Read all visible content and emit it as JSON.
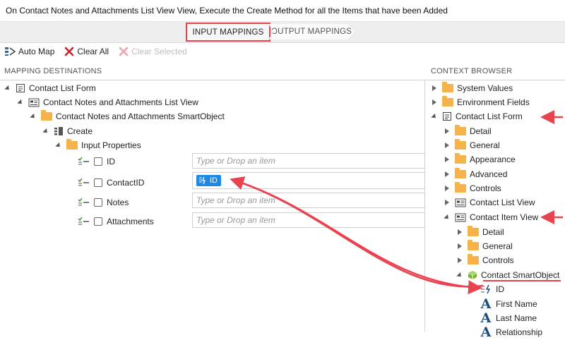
{
  "title": "On Contact Notes and Attachments List View View, Execute the Create Method for all the Items that have been Added",
  "steps": {
    "input": "INPUT MAPPINGS",
    "output": "OUTPUT MAPPINGS"
  },
  "toolbar": {
    "auto_map": "Auto Map",
    "clear_all": "Clear All",
    "clear_selected": "Clear Selected"
  },
  "mapping": {
    "header": "MAPPING DESTINATIONS",
    "form": "Contact List Form",
    "view": "Contact Notes and Attachments List View",
    "smartobject": "Contact Notes and Attachments SmartObject",
    "method": "Create",
    "input_props": "Input Properties",
    "placeholder": "Type or Drop an item",
    "props": [
      {
        "name": "ID",
        "value": ""
      },
      {
        "name": "ContactID",
        "value": "ID"
      },
      {
        "name": "Notes",
        "value": ""
      },
      {
        "name": "Attachments",
        "value": ""
      }
    ]
  },
  "context": {
    "header": "CONTEXT BROWSER",
    "system_values": "System Values",
    "env_fields": "Environment Fields",
    "form": "Contact List Form",
    "form_children": [
      "Detail",
      "General",
      "Appearance",
      "Advanced",
      "Controls"
    ],
    "list_view": "Contact List View",
    "item_view": "Contact Item View",
    "item_view_children": [
      "Detail",
      "General",
      "Controls"
    ],
    "smartobject": "Contact SmartObject",
    "fields": [
      "ID",
      "First Name",
      "Last Name",
      "Relationship"
    ]
  },
  "colors": {
    "accent_red": "#e8434f",
    "chip_blue": "#1e88e5",
    "folder": "#f6b34c"
  }
}
